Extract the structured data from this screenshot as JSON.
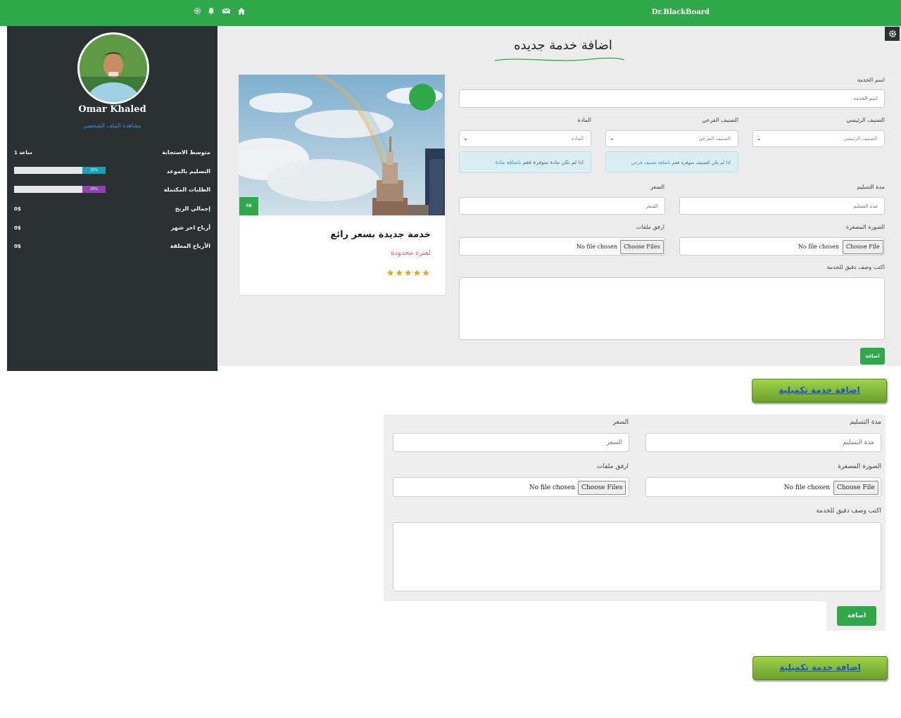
{
  "header": {
    "brand": "Dr.BlackBoard",
    "icons": [
      "home-icon",
      "envelope-icon",
      "bell-icon",
      "gear-icon"
    ]
  },
  "sidebar": {
    "username": "Omar Khaled",
    "profile_link": "مشاهدة الملف الشخصي",
    "stats": [
      {
        "label": "متوسط الاستجابة",
        "value": "1 ساعة"
      },
      {
        "label": "التسليم بالموعد",
        "percent_text": "25%",
        "percent": 25
      },
      {
        "label": "الطلبات المكتملة",
        "percent_text": "25%",
        "percent": 25
      },
      {
        "label": "إجمالي الربح",
        "value": "0$"
      },
      {
        "label": "أرباح اخر شهر",
        "value": "0$"
      },
      {
        "label": "الأرباح المعلقة",
        "value": "0$"
      }
    ]
  },
  "page": {
    "title": "اضافة خدمة جديده"
  },
  "card": {
    "title": "خدمة جديدة بسعر رائع",
    "subtitle": "لفترة محدودة",
    "stars": "★★★★★",
    "price": "0$"
  },
  "form": {
    "service_name_label": "اسم الخدمة",
    "service_name_placeholder": "اسم الخدمة",
    "main_category_label": "الصنيف الرئيسي",
    "main_category_value": "الصنيف الرئيسي",
    "sub_category_label": "الصنيف الفرعي",
    "sub_category_value": "الصنيف الفرعي",
    "subject_label": "المادة",
    "subject_value": "المادة",
    "sub_category_hint": "اذا لم يكن الصنيف متوفرة فقم ",
    "sub_category_hint_link": "باضافة تصنيف فرعي",
    "subject_hint": "اذا لم تكن مادة متوفرة فقم ",
    "subject_hint_link": "باضافة مادة",
    "delivery_label": "مدة التسليم",
    "delivery_placeholder": "مدة التسليم",
    "price_label": "السعر",
    "price_placeholder": "السعر",
    "thumbnail_label": "الصورة المصغرة",
    "attachments_label": "ارفق ملفات",
    "choose_file": "Choose File",
    "choose_files": "Choose Files",
    "no_file": "No file chosen",
    "description_label": "اكتب وصف دقيق للخدمة",
    "submit": "اضافة"
  },
  "extra": {
    "add_complementary": "اضافة خدمة تكميلية"
  },
  "bottom_form": {
    "delivery_label": "مدة التسليم",
    "delivery_placeholder": "مدة التسليم",
    "price_label": "السعر",
    "price_placeholder": "السعر",
    "thumbnail_label": "الصورة المصغرة",
    "attachments_label": "ارفق ملفات",
    "choose_file": "Choose File",
    "choose_files": "Choose Files",
    "no_file": "No file chosen",
    "description_label": "اكتب وصف دقيق للخدمة",
    "submit": "اضافة"
  }
}
